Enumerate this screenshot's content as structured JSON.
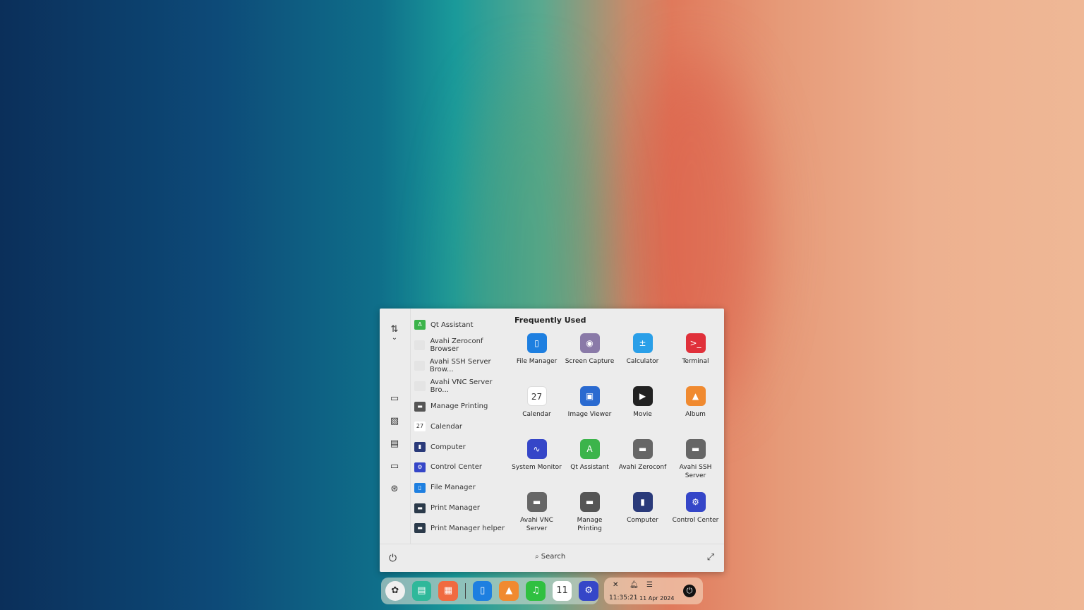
{
  "menu": {
    "side_icons": [
      "sort-icon",
      "computer-icon",
      "pictures-icon",
      "documents-icon",
      "desktop-icon",
      "network-icon"
    ],
    "list": [
      {
        "label": "Qt Assistant",
        "color": "#3cb44b",
        "glyph": "A"
      },
      {
        "label": "Avahi Zeroconf Browser",
        "color": "#e4e4e4",
        "glyph": ""
      },
      {
        "label": "Avahi SSH Server Brow...",
        "color": "#e4e4e4",
        "glyph": ""
      },
      {
        "label": "Avahi VNC Server Bro...",
        "color": "#e4e4e4",
        "glyph": ""
      },
      {
        "label": "Manage Printing",
        "color": "#555",
        "glyph": "▬"
      },
      {
        "label": "Calendar",
        "color": "#fff",
        "glyph": "27"
      },
      {
        "label": "Computer",
        "color": "#2a3a7a",
        "glyph": "▮"
      },
      {
        "label": "Control Center",
        "color": "#3546c8",
        "glyph": "⚙"
      },
      {
        "label": "File Manager",
        "color": "#1e7fe0",
        "glyph": "▯"
      },
      {
        "label": "Print Manager",
        "color": "#2b3a4a",
        "glyph": "▬"
      },
      {
        "label": "Print Manager helper",
        "color": "#2b3a4a",
        "glyph": "▬"
      }
    ],
    "frequent_title": "Frequently Used",
    "grid": [
      {
        "label": "File Manager",
        "color": "#1e7fe0",
        "glyph": "▯"
      },
      {
        "label": "Screen Capture",
        "color": "#8a7aa8",
        "glyph": "◉"
      },
      {
        "label": "Calculator",
        "color": "#2a9fe8",
        "glyph": "±"
      },
      {
        "label": "Terminal",
        "color": "#e0303a",
        "glyph": ">_"
      },
      {
        "label": "Calendar",
        "color": "#ffffff",
        "glyph": "27"
      },
      {
        "label": "Image Viewer",
        "color": "#2a6ad0",
        "glyph": "▣"
      },
      {
        "label": "Movie",
        "color": "#222",
        "glyph": "▶"
      },
      {
        "label": "Album",
        "color": "#f08a30",
        "glyph": "▲"
      },
      {
        "label": "System Monitor",
        "color": "#3546c8",
        "glyph": "∿"
      },
      {
        "label": "Qt Assistant",
        "color": "#3cb44b",
        "glyph": "A"
      },
      {
        "label": "Avahi Zeroconf",
        "color": "#666",
        "glyph": "▬"
      },
      {
        "label": "Avahi SSH Server",
        "color": "#666",
        "glyph": "▬"
      },
      {
        "label": "Avahi VNC Server",
        "color": "#666",
        "glyph": "▬"
      },
      {
        "label": "Manage Printing",
        "color": "#555",
        "glyph": "▬"
      },
      {
        "label": "Computer",
        "color": "#2a3a7a",
        "glyph": "▮"
      },
      {
        "label": "Control Center",
        "color": "#3546c8",
        "glyph": "⚙"
      }
    ],
    "search_label": "Search"
  },
  "dock": [
    {
      "name": "launcher",
      "color": "#f0f0f0",
      "glyph": "✿"
    },
    {
      "name": "multitask-view",
      "color": "#2fb89a",
      "glyph": "▤"
    },
    {
      "name": "app-store",
      "color": "#f06a40",
      "glyph": "▦"
    },
    {
      "name": "file-manager",
      "color": "#1e7fe0",
      "glyph": "▯"
    },
    {
      "name": "album",
      "color": "#f08a30",
      "glyph": "▲"
    },
    {
      "name": "music",
      "color": "#30c040",
      "glyph": "♫"
    },
    {
      "name": "calendar",
      "color": "#ffffff",
      "glyph": "11"
    },
    {
      "name": "control-center",
      "color": "#3546c8",
      "glyph": "⚙"
    }
  ],
  "tray": {
    "time": "11:35:21",
    "date": "11 Apr 2024"
  }
}
